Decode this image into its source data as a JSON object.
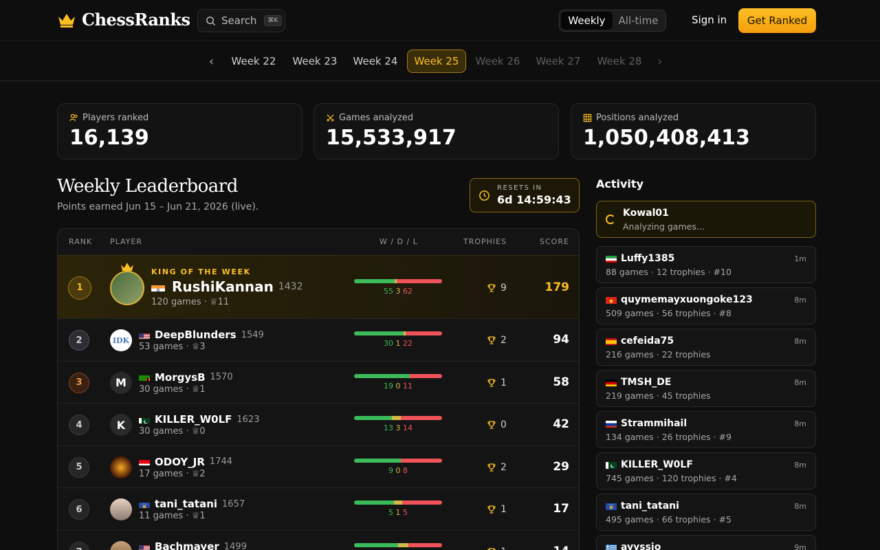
{
  "header": {
    "brand": "ChessRanks",
    "search_label": "Search",
    "search_shortcut": "⌘K",
    "toggle": [
      "Weekly",
      "All-time"
    ],
    "signin": "Sign in",
    "cta": "Get Ranked"
  },
  "weeks": [
    "Week 22",
    "Week 23",
    "Week 24",
    "Week 25",
    "Week 26",
    "Week 27",
    "Week 28"
  ],
  "active_week": "Week 25",
  "stats": [
    {
      "label": "Players ranked",
      "value": "16,139"
    },
    {
      "label": "Games analyzed",
      "value": "15,533,917"
    },
    {
      "label": "Positions analyzed",
      "value": "1,050,408,413"
    }
  ],
  "leaderboard": {
    "title": "Weekly Leaderboard",
    "subtitle": "Points earned Jun 15 – Jun 21, 2026 (live).",
    "resets_label": "RESETS IN",
    "resets_time": "6d 14:59:43",
    "columns": {
      "rank": "RANK",
      "player": "PLAYER",
      "wdl": "W / D / L",
      "trophies": "TROPHIES",
      "score": "SCORE"
    },
    "king_label": "KING OF THE WEEK",
    "rows": [
      {
        "rank": "1",
        "name": "RushiKannan",
        "rating": "1432",
        "games": "120 games",
        "trophy_count": "11",
        "w": "55",
        "d": "3",
        "l": "62",
        "trophies": "9",
        "score": "179",
        "flag": "in"
      },
      {
        "rank": "2",
        "name": "DeepBlunders",
        "rating": "1549",
        "games": "53 games",
        "trophy_count": "3",
        "w": "30",
        "d": "1",
        "l": "22",
        "trophies": "2",
        "score": "94",
        "flag": "us",
        "avatar_text": "IDK"
      },
      {
        "rank": "3",
        "name": "MorgysB",
        "rating": "1570",
        "games": "30 games",
        "trophy_count": "1",
        "w": "19",
        "d": "0",
        "l": "11",
        "trophies": "1",
        "score": "58",
        "flag": "zm",
        "avatar_text": "M"
      },
      {
        "rank": "4",
        "name": "KILLER_W0LF",
        "rating": "1623",
        "games": "30 games",
        "trophy_count": "0",
        "w": "13",
        "d": "3",
        "l": "14",
        "trophies": "0",
        "score": "42",
        "flag": "pk",
        "avatar_text": "K"
      },
      {
        "rank": "5",
        "name": "ODOY_JR",
        "rating": "1744",
        "games": "17 games",
        "trophy_count": "2",
        "w": "9",
        "d": "0",
        "l": "8",
        "trophies": "2",
        "score": "29",
        "flag": "id"
      },
      {
        "rank": "6",
        "name": "tani_tatani",
        "rating": "1657",
        "games": "11 games",
        "trophy_count": "1",
        "w": "5",
        "d": "1",
        "l": "5",
        "trophies": "1",
        "score": "17",
        "flag": "xk"
      },
      {
        "rank": "7",
        "name": "Bachmayer",
        "rating": "1499",
        "games": "",
        "trophy_count": "",
        "w": "",
        "d": "",
        "l": "",
        "trophies": "1",
        "score": "14",
        "flag": "us",
        "bar_w": 50,
        "bar_d": 12,
        "bar_l": 38
      }
    ]
  },
  "activity": {
    "title": "Activity",
    "items": [
      {
        "name": "Kowal01",
        "meta": "Analyzing games…",
        "time": "",
        "live": true
      },
      {
        "name": "Luffy1385",
        "meta": "88 games · 12 trophies · #10",
        "time": "1m",
        "flag": "ir"
      },
      {
        "name": "quymemayxuongoke123",
        "meta": "509 games · 56 trophies · #8",
        "time": "8m",
        "flag": "vn"
      },
      {
        "name": "cefeida75",
        "meta": "216 games · 22 trophies",
        "time": "8m",
        "flag": "es"
      },
      {
        "name": "TMSH_DE",
        "meta": "219 games · 45 trophies",
        "time": "8m",
        "flag": "de"
      },
      {
        "name": "Strammihail",
        "meta": "134 games · 26 trophies · #9",
        "time": "8m",
        "flag": "ru"
      },
      {
        "name": "KILLER_W0LF",
        "meta": "745 games · 120 trophies · #4",
        "time": "8m",
        "flag": "pk"
      },
      {
        "name": "tani_tatani",
        "meta": "495 games · 66 trophies · #5",
        "time": "8m",
        "flag": "xk"
      },
      {
        "name": "ayyssio",
        "meta": "",
        "time": "9m",
        "flag": "gr"
      }
    ]
  }
}
